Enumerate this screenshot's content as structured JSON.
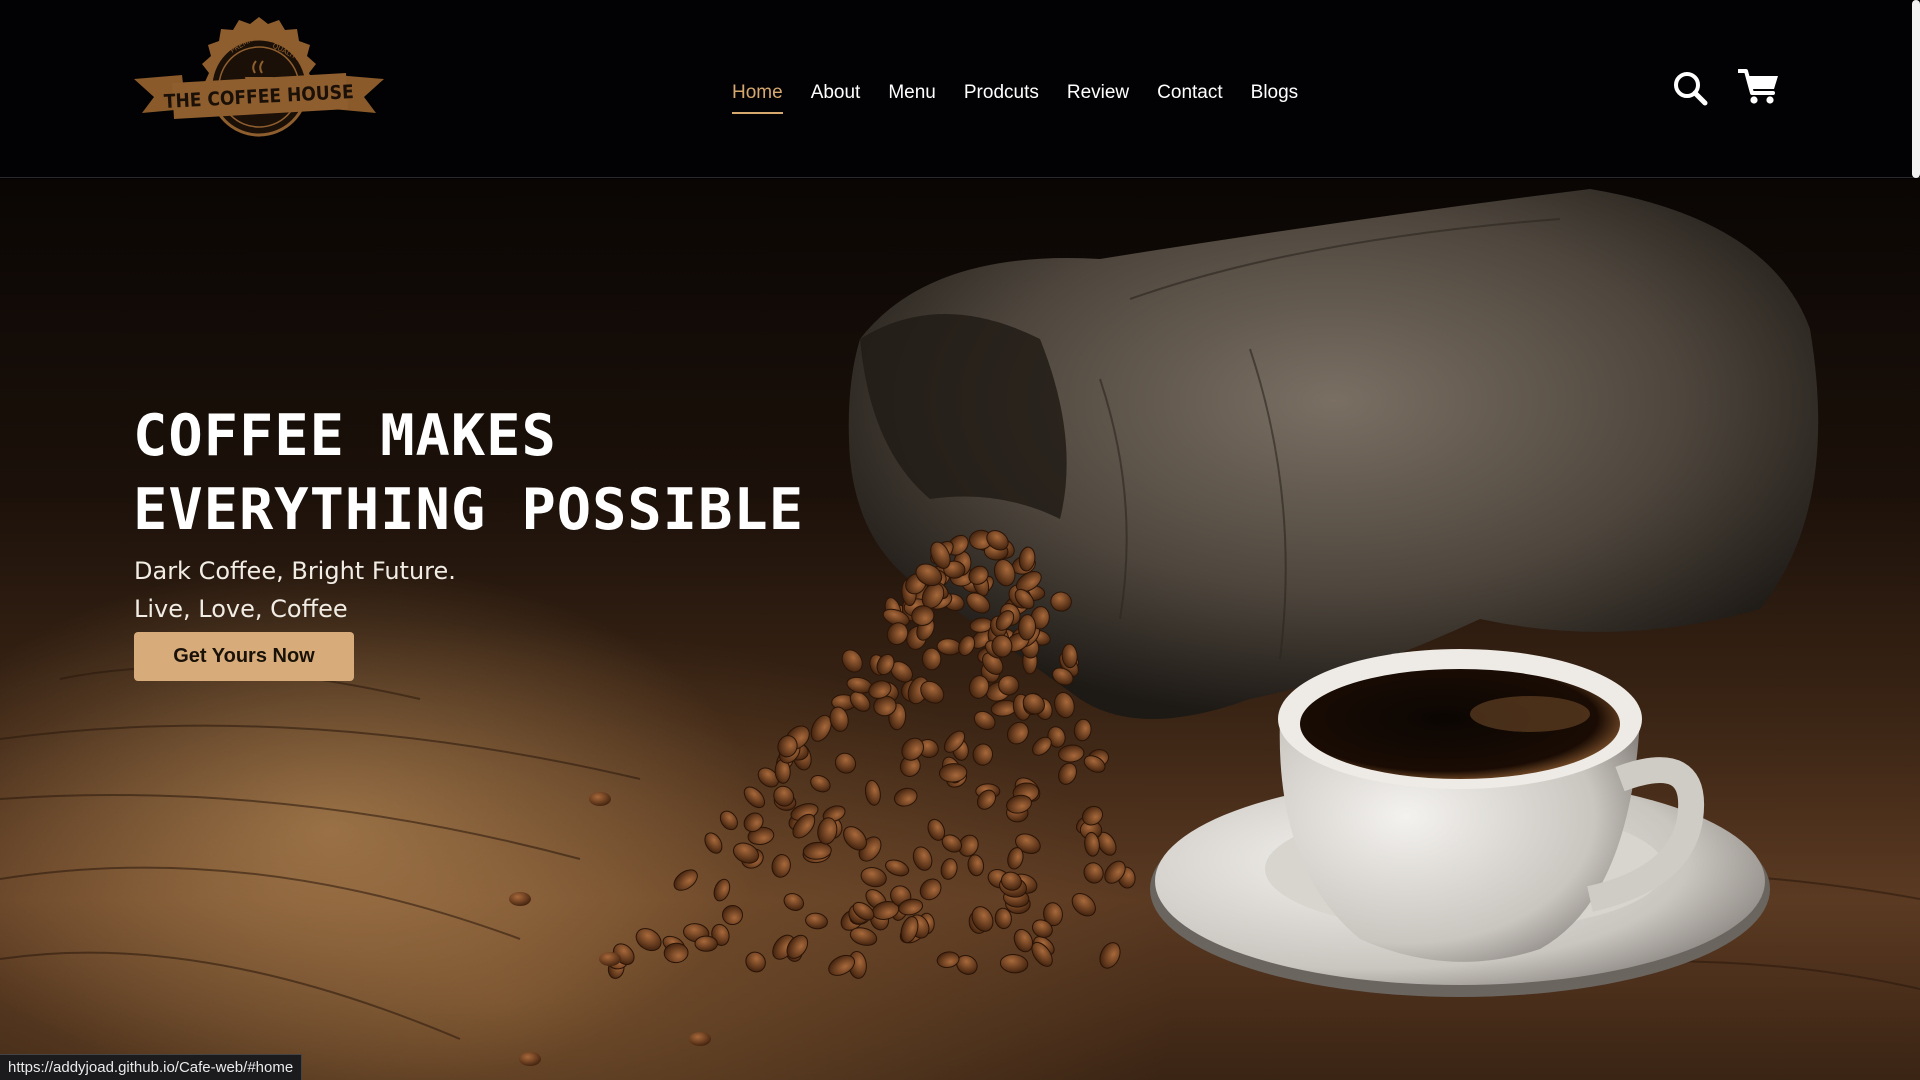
{
  "brand": {
    "logo_text": "THE COFFEE HOUSE",
    "logo_badge_left": "PREMIUM",
    "logo_badge_right": "QUALITY"
  },
  "nav": {
    "items": [
      {
        "label": "Home",
        "active": true
      },
      {
        "label": "About",
        "active": false
      },
      {
        "label": "Menu",
        "active": false
      },
      {
        "label": "Prodcuts",
        "active": false
      },
      {
        "label": "Review",
        "active": false
      },
      {
        "label": "Contact",
        "active": false
      },
      {
        "label": "Blogs",
        "active": false
      }
    ]
  },
  "header_icons": {
    "search": "search-icon",
    "cart": "cart-icon"
  },
  "hero": {
    "title_line1": "COFFEE MAKES",
    "title_line2": "EVERYTHING POSSIBLE",
    "subtitle_line1": "Dark Coffee, Bright Future.",
    "subtitle_line2": "Live, Love, Coffee",
    "cta_label": "Get Yours Now"
  },
  "status_bar": {
    "url": "https://addyjoad.github.io/Cafe-web/#home"
  },
  "colors": {
    "accent": "#d6a86e",
    "button_bg": "#d7ab7a",
    "header_bg": "#020204"
  }
}
